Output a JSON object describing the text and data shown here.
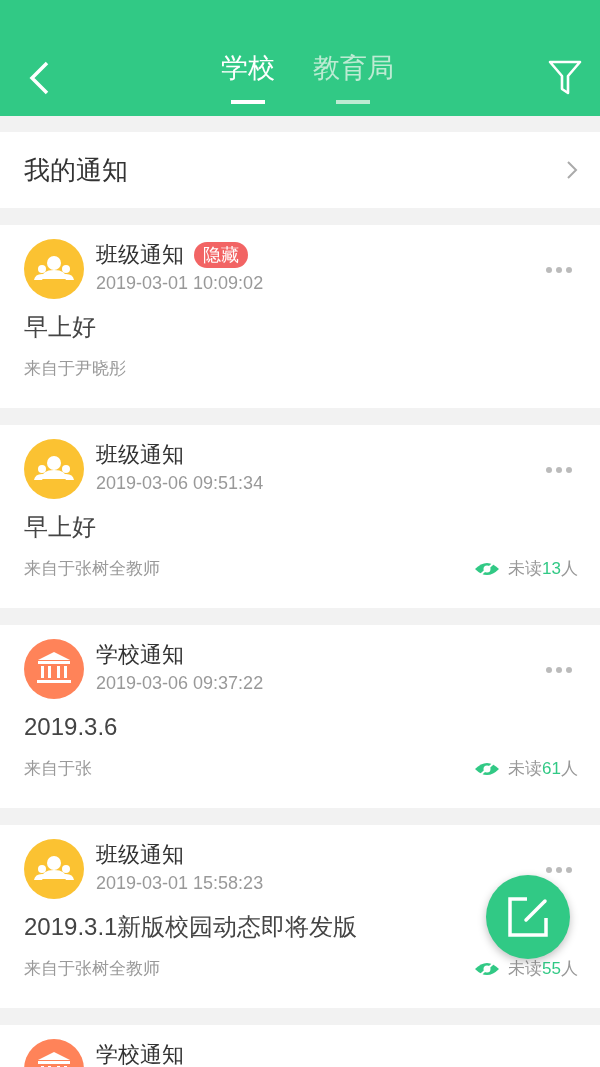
{
  "header": {
    "tabs": [
      {
        "label": "学校",
        "selected": true
      },
      {
        "label": "教育局",
        "selected": false
      }
    ]
  },
  "my_notices": {
    "label": "我的通知"
  },
  "notices": [
    {
      "kind": "class",
      "title": "班级通知",
      "tag": "隐藏",
      "time": "2019-03-01 10:09:02",
      "content": "早上好",
      "from": "来自于尹晓彤"
    },
    {
      "kind": "class",
      "title": "班级通知",
      "time": "2019-03-06 09:51:34",
      "content": "早上好",
      "from": "来自于张树全教师",
      "unread": {
        "label": "未读",
        "count": "13",
        "unit": "人"
      }
    },
    {
      "kind": "school",
      "title": "学校通知",
      "time": "2019-03-06 09:37:22",
      "content": "2019.3.6",
      "from": "来自于张",
      "unread": {
        "label": "未读",
        "count": "61",
        "unit": "人"
      }
    },
    {
      "kind": "class",
      "title": "班级通知",
      "time": "2019-03-01 15:58:23",
      "content": "2019.3.1新版校园动态即将发版",
      "from": "来自于张树全教师",
      "unread": {
        "label": "未读",
        "count": "55",
        "unit": "人"
      }
    },
    {
      "kind": "school",
      "title": "学校通知"
    }
  ]
}
